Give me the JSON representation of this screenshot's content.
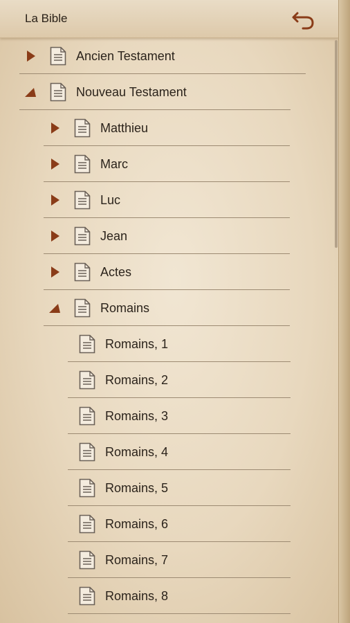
{
  "header": {
    "title": "La Bible",
    "back_icon": "undo-arrow-icon"
  },
  "colors": {
    "arrow": "#8a3c18",
    "separator": "#9c8a72",
    "text": "#2b231b"
  },
  "tree": {
    "ancien": {
      "label": "Ancien Testament",
      "expanded": false
    },
    "nouveau": {
      "label": "Nouveau Testament",
      "expanded": true
    },
    "books": [
      {
        "label": "Matthieu",
        "expanded": false
      },
      {
        "label": "Marc",
        "expanded": false
      },
      {
        "label": "Luc",
        "expanded": false
      },
      {
        "label": "Jean",
        "expanded": false
      },
      {
        "label": "Actes",
        "expanded": false
      },
      {
        "label": "Romains",
        "expanded": true
      }
    ],
    "chapters": [
      "Romains, 1",
      "Romains, 2",
      "Romains, 3",
      "Romains, 4",
      "Romains, 5",
      "Romains, 6",
      "Romains, 7",
      "Romains, 8"
    ]
  }
}
